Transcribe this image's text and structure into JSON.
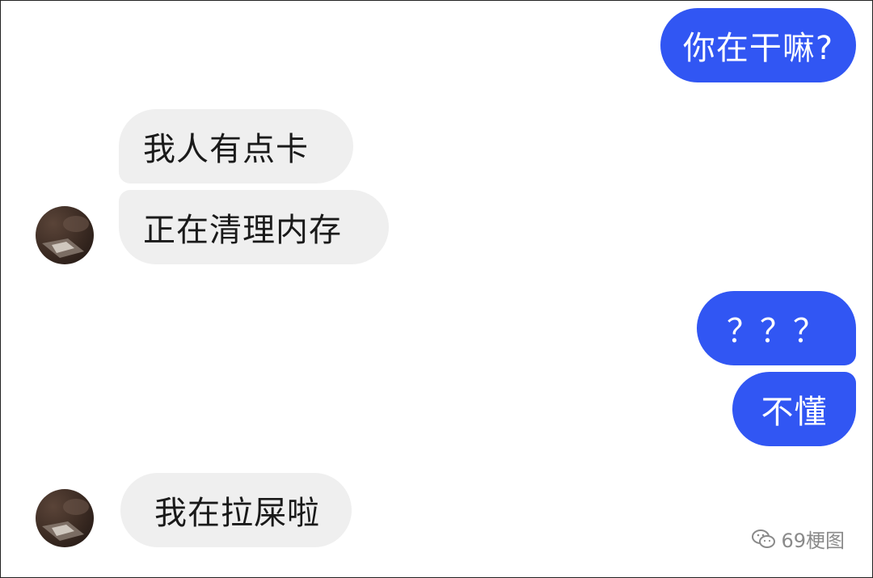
{
  "messages": {
    "m1": {
      "text": "你在干嘛?"
    },
    "m2": {
      "text": "我人有点卡"
    },
    "m3": {
      "text": "正在清理内存"
    },
    "m4": {
      "text": "？？？"
    },
    "m5": {
      "text": "不懂"
    },
    "m6": {
      "text": "我在拉屎啦"
    }
  },
  "watermark": {
    "text": "69梗图",
    "icon": "wechat-icon"
  },
  "colors": {
    "outgoing_bubble": "#3156f3",
    "incoming_bubble": "#efefef",
    "outgoing_text": "#ffffff",
    "incoming_text": "#1a1a1a"
  }
}
